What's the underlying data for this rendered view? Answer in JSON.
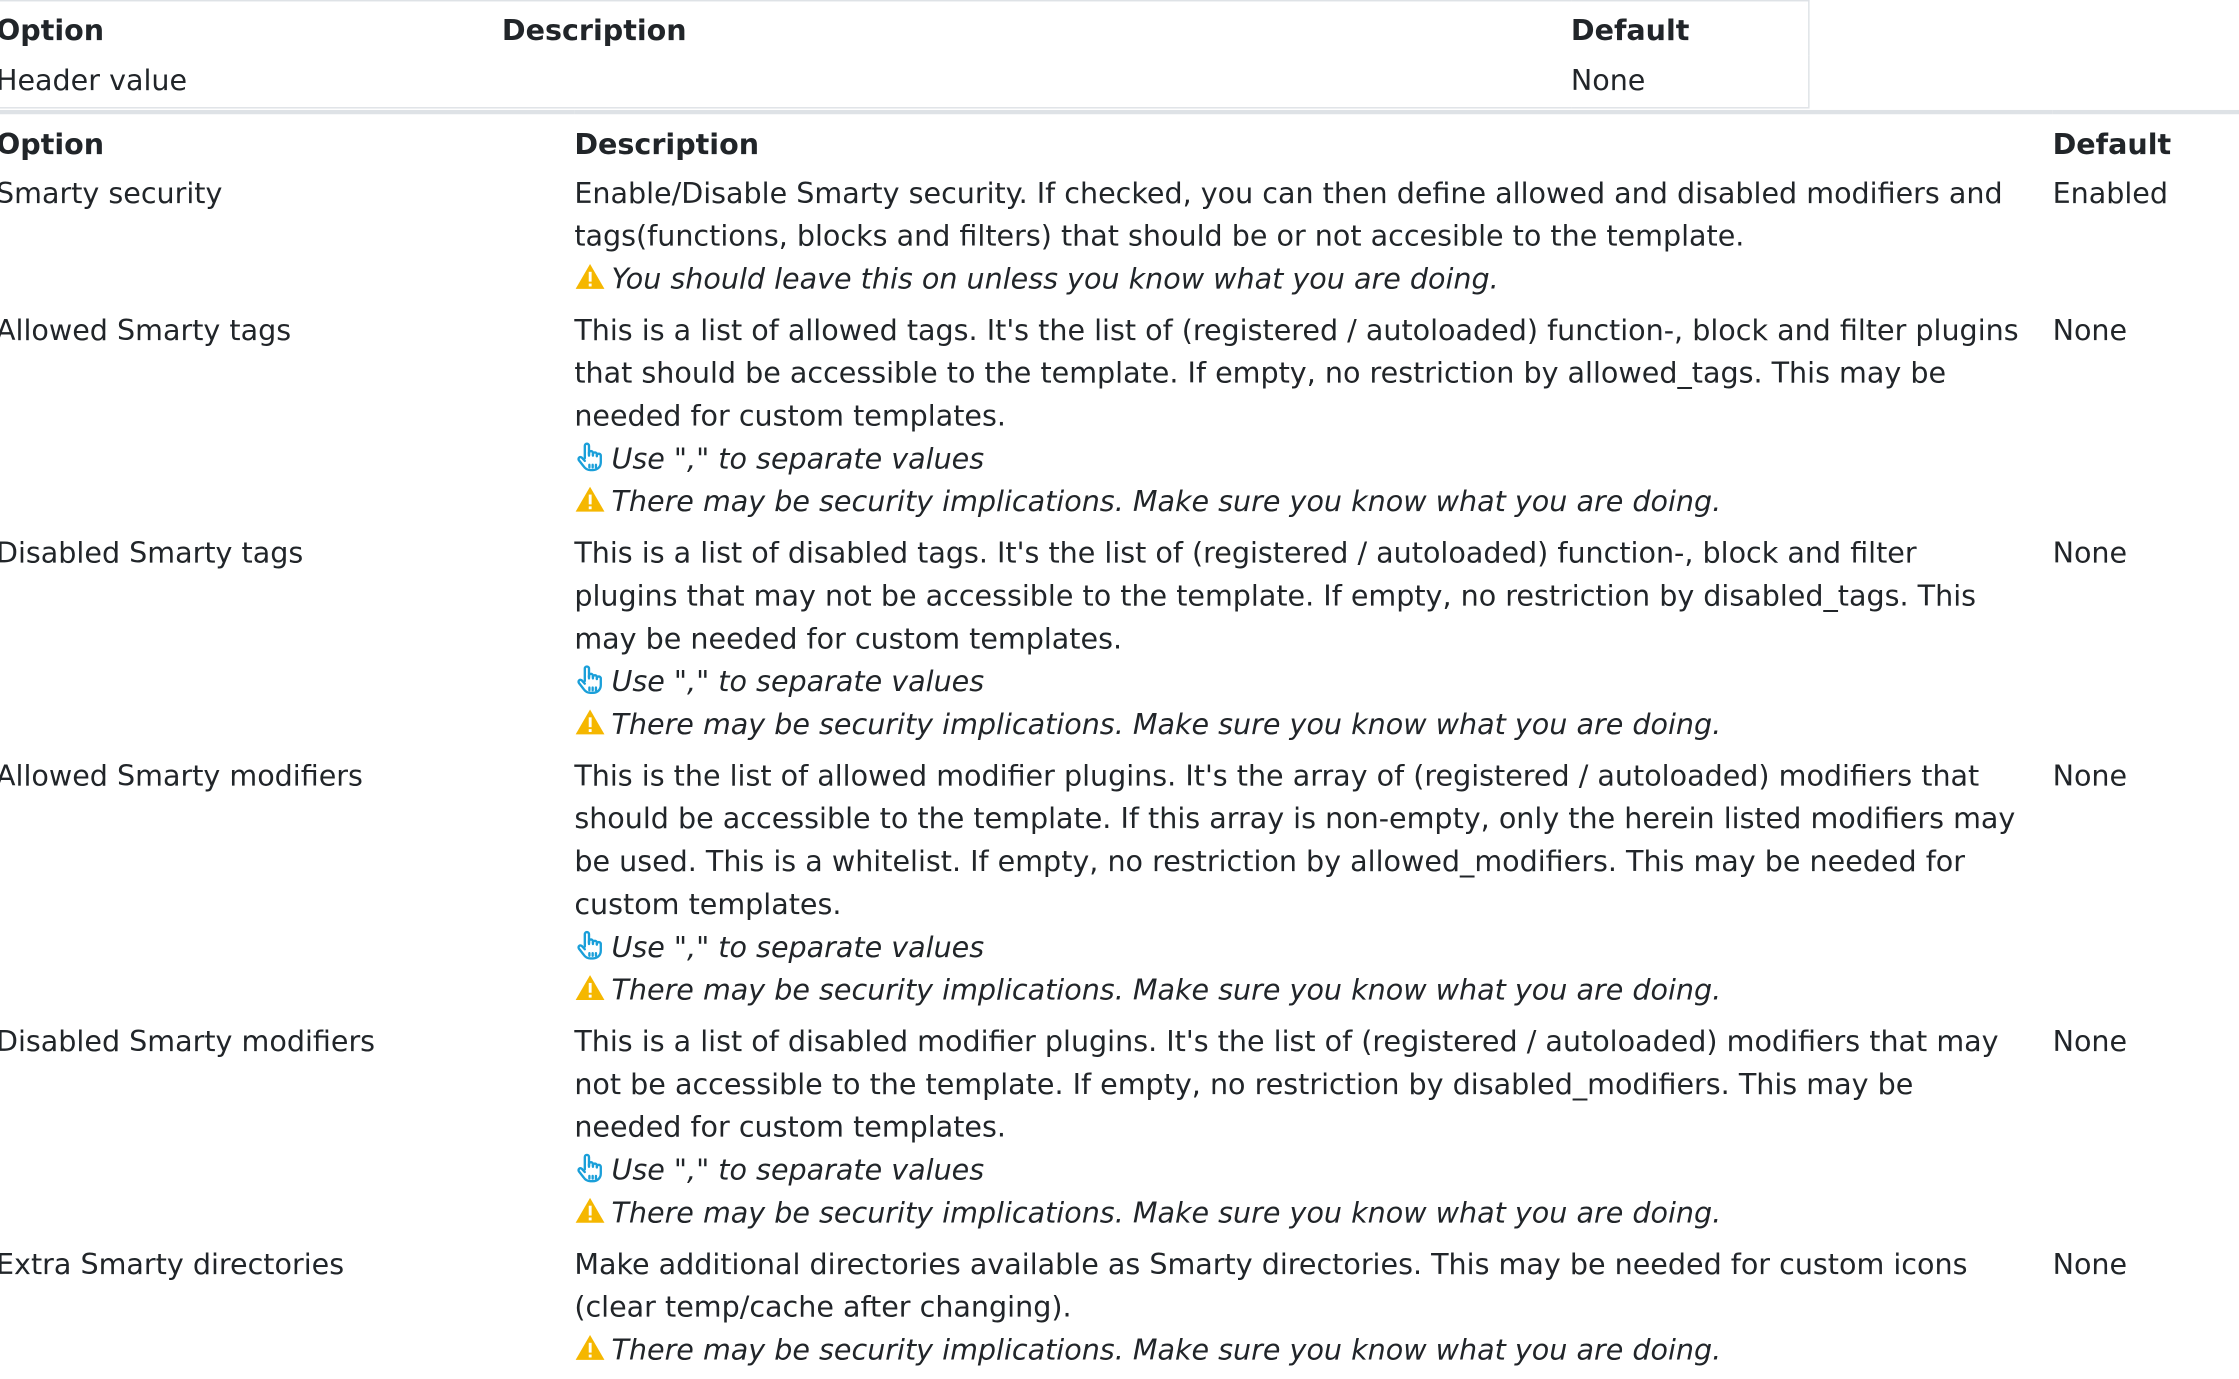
{
  "header_table": {
    "columns": [
      "Option",
      "Description",
      "Default"
    ],
    "row": {
      "option": "Header value",
      "description": "",
      "default": "None"
    }
  },
  "main_table": {
    "columns": [
      "Option",
      "Description",
      "Default"
    ],
    "rows": [
      {
        "option": "Smarty security",
        "description": "Enable/Disable Smarty security. If checked, you can then define allowed and disabled modifiers and tags(functions, blocks and filters) that should be or not accesible to the template.",
        "tip": "",
        "warning": "You should leave this on unless you know what you are doing.",
        "default": "Enabled"
      },
      {
        "option": "Allowed Smarty tags",
        "description": "This is a list of allowed tags. It's the list of (registered / autoloaded) function-, block and filter plugins that should be accessible to the template. If empty, no restriction by allowed_tags. This may be needed for custom templates.",
        "tip": "Use \",\" to separate values",
        "warning": "There may be security implications. Make sure you know what you are doing.",
        "default": "None"
      },
      {
        "option": "Disabled Smarty tags",
        "description": "This is a list of disabled tags. It's the list of (registered / autoloaded) function-, block and filter plugins that may not be accessible to the template. If empty, no restriction by disabled_tags. This may be needed for custom templates.",
        "tip": "Use \",\" to separate values",
        "warning": "There may be security implications. Make sure you know what you are doing.",
        "default": "None"
      },
      {
        "option": "Allowed Smarty modifiers",
        "description": "This is the list of allowed modifier plugins. It's the array of (registered / autoloaded) modifiers that should be accessible to the template. If this array is non-empty, only the herein listed modifiers may be used. This is a whitelist. If empty, no restriction by allowed_modifiers. This may be needed for custom templates.",
        "tip": "Use \",\" to separate values",
        "warning": "There may be security implications. Make sure you know what you are doing.",
        "default": "None"
      },
      {
        "option": "Disabled Smarty modifiers",
        "description": "This is a list of disabled modifier plugins. It's the list of (registered / autoloaded) modifiers that may not be accessible to the template. If empty, no restriction by disabled_modifiers. This may be needed for custom templates.",
        "tip": "Use \",\" to separate values",
        "warning": "There may be security implications. Make sure you know what you are doing.",
        "default": "None"
      },
      {
        "option": "Extra Smarty directories",
        "description": "Make additional directories available as Smarty directories. This may be needed for custom icons (clear temp/cache after changing).",
        "tip": "",
        "warning": "There may be security implications. Make sure you know what you are doing.",
        "default": "None"
      }
    ]
  },
  "icons": {
    "warning": "warning-triangle-icon",
    "tip": "pointing-hand-icon"
  },
  "colors": {
    "warning": "#f5b700",
    "tip": "#1a9fd9",
    "border": "#dee2e6"
  }
}
